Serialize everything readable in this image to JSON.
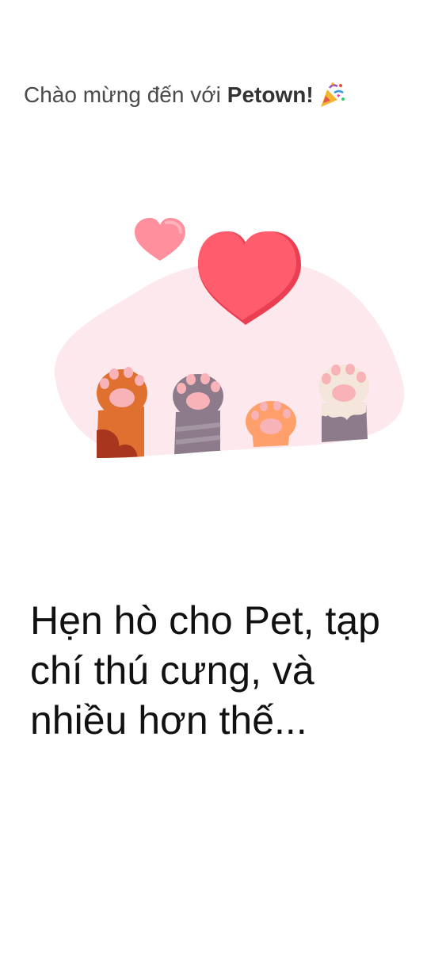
{
  "welcome": {
    "prefix": "Chào mừng đến với",
    "brand": "Petown!",
    "emoji_icon": "party-popper-icon"
  },
  "illustration": {
    "icons": [
      "heart-icon",
      "paw-icon"
    ],
    "colors": {
      "blob": "#fde9ed",
      "heart_big": "#ff5c6e",
      "heart_small": "#ff8f9c",
      "paw_orange": "#e07030",
      "paw_purple": "#8d7b8c",
      "paw_peach": "#ff9f6b",
      "paw_cream": "#f5e6dc",
      "pad_pink": "#f7b3b8"
    }
  },
  "headline": "Hẹn hò cho Pet, tạp chí thú cưng, và nhiều hơn thế..."
}
